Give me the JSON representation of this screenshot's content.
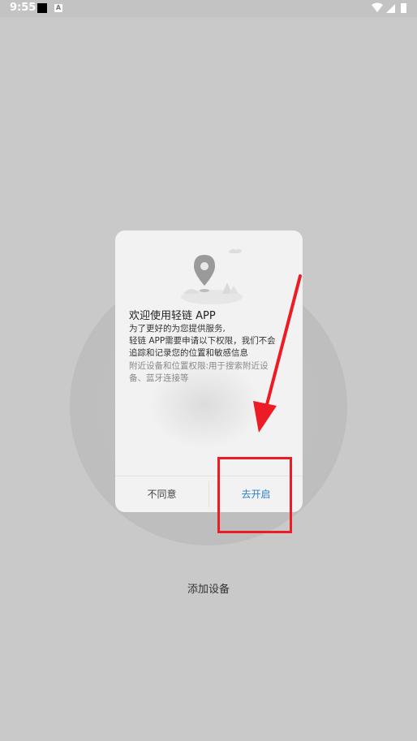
{
  "status_bar": {
    "time": "9:55",
    "notification_icon": "a-icon",
    "wifi_icon": "wifi-icon",
    "signal_icon": "signal-icon",
    "battery_icon": "battery-icon"
  },
  "dialog": {
    "illustration_icon": "location-pin-icon",
    "title": "欢迎使用轻链 APP",
    "lines": [
      "为了更好的为您提供服务,",
      "轻链 APP需要申请以下权限，我们不会",
      "追踪和记录您的位置和敏感信息",
      "附近设备和位置权限:用于搜索附近设",
      "备、蓝牙连接等"
    ],
    "disagree_label": "不同意",
    "open_label": "去开启"
  },
  "main": {
    "add_device_label": "添加设备"
  },
  "annotations": {
    "highlight_color": "#ec1c24",
    "highlight_target": "去开启"
  },
  "colors": {
    "background": "#c9c9c9",
    "dialog": "#f2f2f2",
    "accent": "#2a7fd6"
  }
}
